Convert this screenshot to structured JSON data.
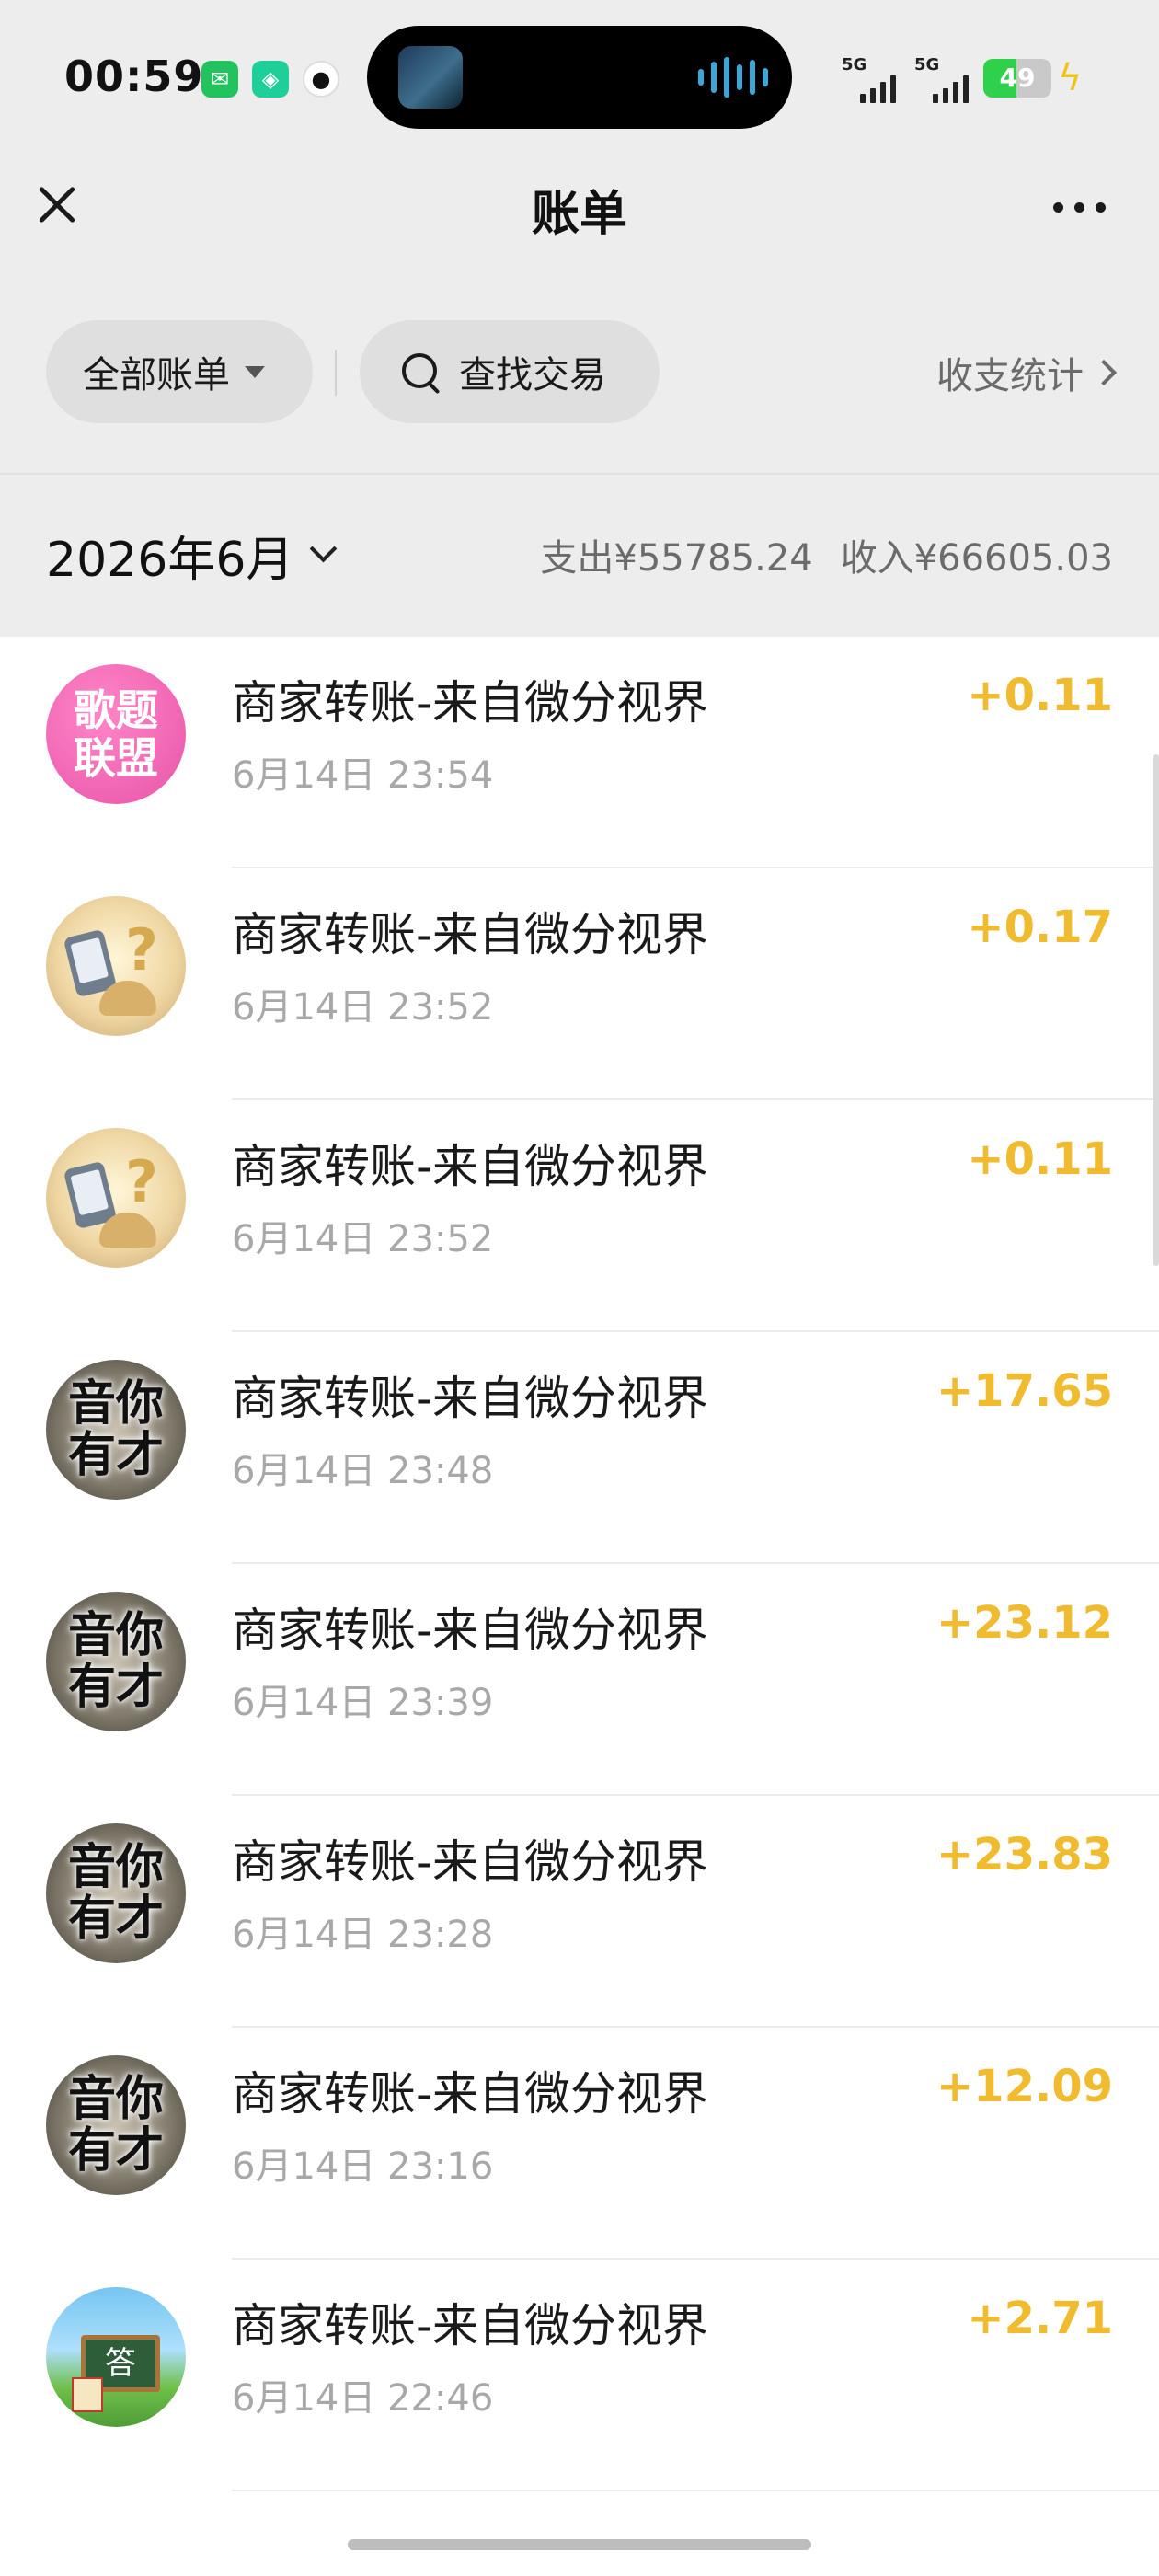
{
  "status_bar": {
    "time": "00:59",
    "network_1": "5G",
    "network_2": "5G",
    "battery": "49",
    "battery_fraction": 0.49
  },
  "nav": {
    "title": "账单"
  },
  "filters": {
    "all_bills": "全部账单",
    "search_label": "查找交易",
    "stats_link": "收支统计"
  },
  "month_bar": {
    "month": "2026年6月",
    "expense": "支出¥55785.24",
    "income": "收入¥66605.03"
  },
  "transactions": [
    {
      "title": "商家转账-来自微分视界",
      "time": "6月14日 23:54",
      "amount": "+0.11",
      "avatar": "歌题联盟",
      "avatar_text": "歌题联盟"
    },
    {
      "title": "商家转账-来自微分视界",
      "time": "6月14日 23:52",
      "amount": "+0.17",
      "avatar": "challenge-icon"
    },
    {
      "title": "商家转账-来自微分视界",
      "time": "6月14日 23:52",
      "amount": "+0.11",
      "avatar": "challenge-icon"
    },
    {
      "title": "商家转账-来自微分视界",
      "time": "6月14日 23:48",
      "amount": "+17.65",
      "avatar": "音你有才",
      "avatar_text": "音你有才"
    },
    {
      "title": "商家转账-来自微分视界",
      "time": "6月14日 23:39",
      "amount": "+23.12",
      "avatar": "音你有才",
      "avatar_text": "音你有才"
    },
    {
      "title": "商家转账-来自微分视界",
      "time": "6月14日 23:28",
      "amount": "+23.83",
      "avatar": "音你有才",
      "avatar_text": "音你有才"
    },
    {
      "title": "商家转账-来自微分视界",
      "time": "6月14日 23:16",
      "amount": "+12.09",
      "avatar": "音你有才",
      "avatar_text": "音你有才"
    },
    {
      "title": "商家转账-来自微分视界",
      "time": "6月14日 22:46",
      "amount": "+2.71",
      "avatar": "答",
      "avatar_text": "答"
    }
  ],
  "colors": {
    "amount_income": "#f0bb2e",
    "top_background": "#ededed",
    "list_background": "#ffffff",
    "secondary_text": "#a8a8a8"
  }
}
